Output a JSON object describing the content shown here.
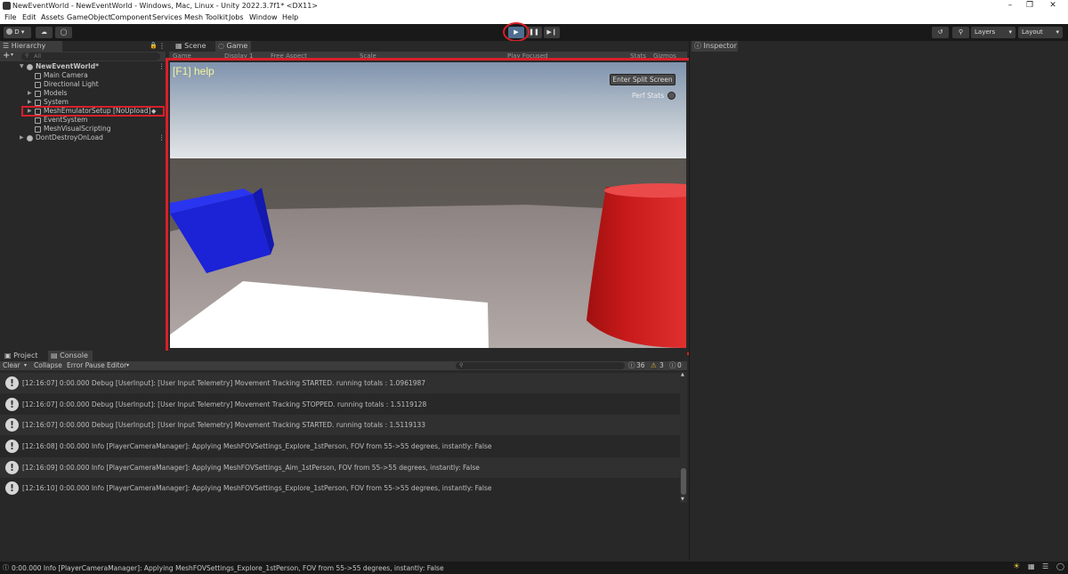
{
  "window": {
    "title": "NewEventWorld - NewEventWorld - Windows, Mac, Linux - Unity 2022.3.7f1* <DX11>"
  },
  "menu": [
    "File",
    "Edit",
    "Assets",
    "GameObject",
    "Component",
    "Services",
    "Mesh Toolkit",
    "Jobs",
    "Window",
    "Help"
  ],
  "toolbar": {
    "account_label": "D",
    "layers_label": "Layers",
    "layout_label": "Layout"
  },
  "hierarchy": {
    "tab": "Hierarchy",
    "search_placeholder": "All",
    "rows": [
      {
        "label": "NewEventWorld*",
        "kind": "scene",
        "expanded": true
      },
      {
        "label": "Main Camera",
        "kind": "object"
      },
      {
        "label": "Directional Light",
        "kind": "object"
      },
      {
        "label": "Models",
        "kind": "object",
        "collapsed": true
      },
      {
        "label": "System",
        "kind": "object",
        "collapsed": true
      },
      {
        "label": "MeshEmulatorSetup [NoUpload]",
        "kind": "object",
        "collapsed": true,
        "highlighted": true
      },
      {
        "label": "EventSystem",
        "kind": "object"
      },
      {
        "label": "MeshVisualScripting",
        "kind": "object"
      },
      {
        "label": "DontDestroyOnLoad",
        "kind": "scene",
        "collapsed": true
      }
    ]
  },
  "view_tabs": {
    "scene": "Scene",
    "game": "Game"
  },
  "game_toolbar": {
    "game": "Game",
    "display": "Display 1",
    "aspect": "Free Aspect",
    "scale": "Scale",
    "play_focused": "Play Focused",
    "stats": "Stats",
    "gizmos": "Gizmos"
  },
  "game_view": {
    "help_text": "[F1] help",
    "split_button": "Enter Split Screen",
    "perf_stats": "Perf Stats"
  },
  "inspector": {
    "tab": "Inspector"
  },
  "bottom_tabs": {
    "project": "Project",
    "console": "Console"
  },
  "console": {
    "clear": "Clear",
    "collapse": "Collapse",
    "error_pause": "Error Pause",
    "editor": "Editor",
    "count_info": "36",
    "count_warn": "3",
    "count_error": "0",
    "entries": [
      "[12:16:07] 0:00.000 Debug [UserInput]: [User Input Telemetry] Movement Tracking STARTED. running totals : 1.0961987",
      "[12:16:07] 0:00.000 Debug [UserInput]: [User Input Telemetry] Movement Tracking STOPPED. running totals : 1.5119128",
      "[12:16:07] 0:00.000 Debug [UserInput]: [User Input Telemetry] Movement Tracking STARTED. running totals : 1.5119133",
      "[12:16:08] 0:00.000 Info [PlayerCameraManager]: Applying MeshFOVSettings_Explore_1stPerson, FOV from 55->55 degrees, instantly: False",
      "[12:16:09] 0:00.000 Info [PlayerCameraManager]: Applying MeshFOVSettings_Aim_1stPerson, FOV from 55->55 degrees, instantly: False",
      "[12:16:10] 0:00.000 Info [PlayerCameraManager]: Applying MeshFOVSettings_Explore_1stPerson, FOV from 55->55 degrees, instantly: False"
    ]
  },
  "status_bar": {
    "message": "0:00.000 Info [PlayerCameraManager]: Applying MeshFOVSettings_Explore_1stPerson, FOV from 55->55 degrees, instantly: False"
  },
  "colors": {
    "highlight": "#d6202a",
    "cube": "#1c22d6",
    "cylinder": "#c81818"
  }
}
